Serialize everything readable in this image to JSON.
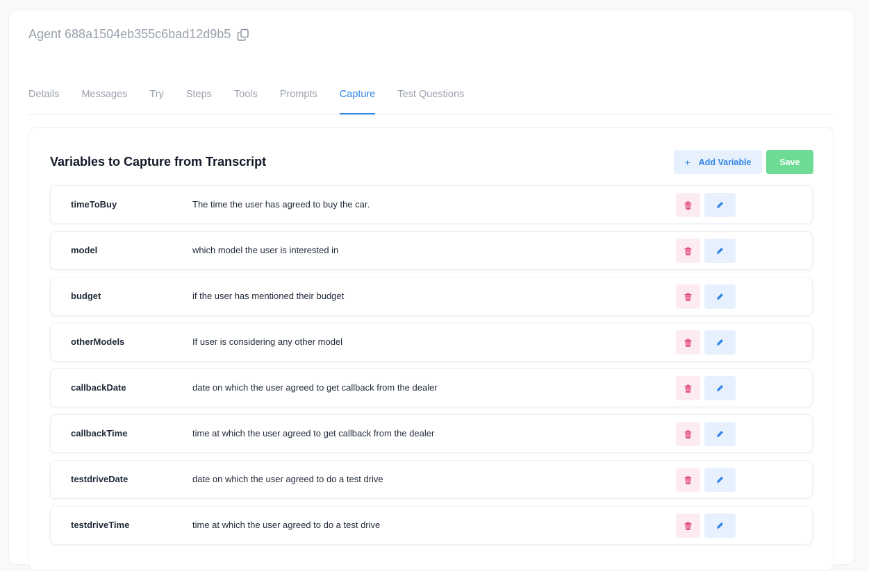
{
  "header": {
    "agent_title": "Agent 688a1504eb355c6bad12d9b5",
    "copy_icon": "copy-icon"
  },
  "tabs": [
    {
      "label": "Details"
    },
    {
      "label": "Messages"
    },
    {
      "label": "Try"
    },
    {
      "label": "Steps"
    },
    {
      "label": "Tools"
    },
    {
      "label": "Prompts"
    },
    {
      "label": "Capture",
      "active": true
    },
    {
      "label": "Test Questions"
    }
  ],
  "panel": {
    "title": "Variables to Capture from Transcript",
    "add_label": "Add Variable",
    "add_icon": "plus-icon",
    "save_label": "Save"
  },
  "variables": [
    {
      "name": "timeToBuy",
      "description": "The time the user has agreed to buy the car."
    },
    {
      "name": "model",
      "description": "which model the user is interested in"
    },
    {
      "name": "budget",
      "description": "if the user has mentioned their budget"
    },
    {
      "name": "otherModels",
      "description": "If user is considering any other model"
    },
    {
      "name": "callbackDate",
      "description": "date on which the user agreed to get callback from the dealer"
    },
    {
      "name": "callbackTime",
      "description": "time at which the user agreed to get callback from the dealer"
    },
    {
      "name": "testdriveDate",
      "description": "date on which the user agreed to do a test drive"
    },
    {
      "name": "testdriveTime",
      "description": "time at which the user agreed to do a test drive"
    }
  ],
  "row_actions": {
    "delete_icon": "trash-icon",
    "edit_icon": "pencil-icon"
  },
  "colors": {
    "accent": "#2f86e6",
    "save": "#6ddb93",
    "delete_icon": "#e0457b",
    "delete_bg": "#fdecef",
    "edit_bg": "#e6f1fd"
  }
}
